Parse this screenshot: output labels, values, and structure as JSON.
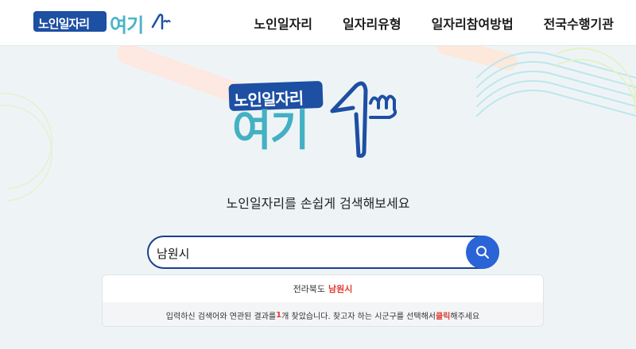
{
  "header": {
    "logo": {
      "box_text": "노인일자리",
      "teal_text": "여기"
    },
    "nav": [
      {
        "label": "노인일자리"
      },
      {
        "label": "일자리유형"
      },
      {
        "label": "일자리참여방법"
      },
      {
        "label": "전국수행기관"
      }
    ]
  },
  "hero": {
    "logo": {
      "box_text": "노인일자리",
      "teal_text": "여기"
    },
    "tagline": "노인일자리를 손쉽게 검색해보세요"
  },
  "search": {
    "value": "남원시",
    "icon": "search-icon"
  },
  "results": {
    "items": [
      {
        "region": "전라북도",
        "city": "남원시"
      }
    ],
    "note": {
      "prefix": "입력하신 검색어와 연관된 결과를 ",
      "count": "1",
      "middle": "개 찾았습니다. 찾고자 하는 시군구를 선택해서 ",
      "click": "클릭",
      "suffix": "해주세요"
    }
  },
  "colors": {
    "brand_blue": "#1d4fa3",
    "brand_teal": "#44b0c4",
    "search_border": "#1b3f8c",
    "search_button": "#2a64d6",
    "highlight_red": "#e03c31"
  }
}
